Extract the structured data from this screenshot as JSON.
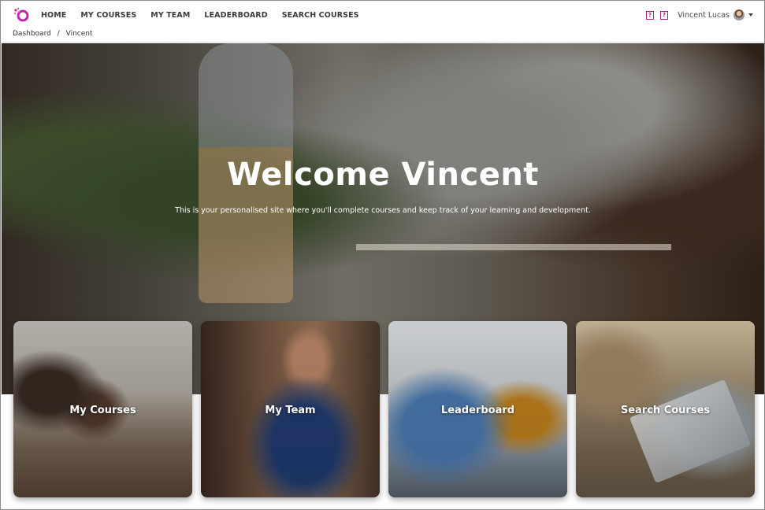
{
  "nav": {
    "items": [
      "HOME",
      "MY COURSES",
      "MY TEAM",
      "LEADERBOARD",
      "SEARCH COURSES"
    ]
  },
  "user": {
    "name": "Vincent Lucas"
  },
  "breadcrumb": {
    "items": [
      "Dashboard",
      "/",
      "Vincent"
    ]
  },
  "hero": {
    "title": "Welcome Vincent",
    "subtitle": "This is your personalised site where you'll complete courses and keep track of your learning and development."
  },
  "cards": [
    {
      "label": "My Courses"
    },
    {
      "label": "My Team"
    },
    {
      "label": "Leaderboard"
    },
    {
      "label": "Search Courses"
    }
  ],
  "colors": {
    "accent": "#a0208a",
    "logo": "#c026a6"
  },
  "icons": {
    "logo": "logo-icon",
    "help1": "help-icon",
    "help2": "help-icon",
    "avatar": "avatar",
    "dropdown": "chevron-down-icon"
  }
}
